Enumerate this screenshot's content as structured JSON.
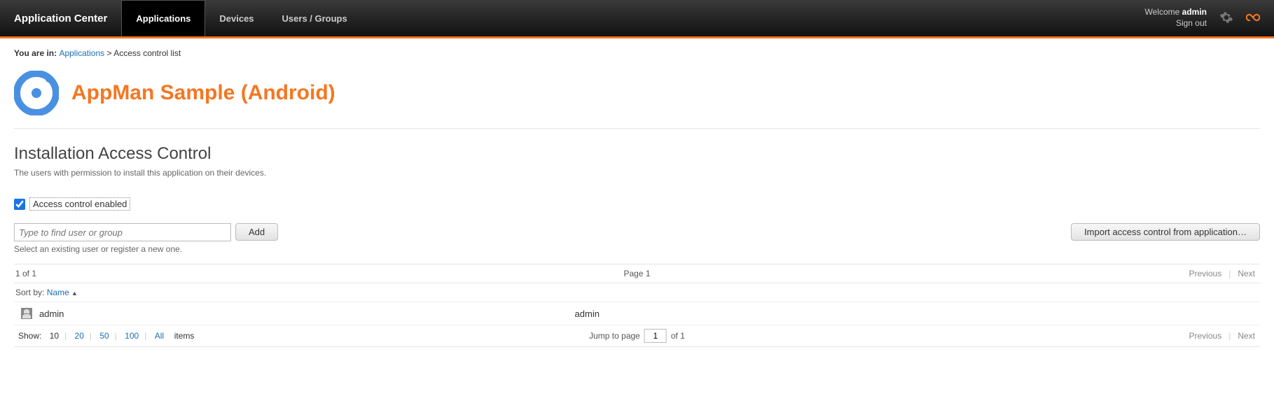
{
  "header": {
    "brand": "Application Center",
    "tabs": [
      {
        "label": "Applications",
        "active": true
      },
      {
        "label": "Devices",
        "active": false
      },
      {
        "label": "Users / Groups",
        "active": false
      }
    ],
    "welcome_prefix": "Welcome ",
    "username": "admin",
    "signout": "Sign out"
  },
  "breadcrumb": {
    "prefix": "You are in: ",
    "link": "Applications",
    "sep": " > ",
    "current": "Access control list"
  },
  "app": {
    "title": "AppMan Sample (Android)"
  },
  "section": {
    "title": "Installation Access Control",
    "desc": "The users with permission to install this application on their devices."
  },
  "access_control": {
    "checkbox_label": "Access control enabled",
    "checked": true
  },
  "search": {
    "placeholder": "Type to find user or group",
    "add_label": "Add",
    "helper": "Select an existing user or register a new one.",
    "import_label": "Import access control from application…"
  },
  "list": {
    "count_text": "1 of 1",
    "page_label": "Page 1",
    "prev": "Previous",
    "next": "Next",
    "sort_label": "Sort by: ",
    "sort_field": "Name",
    "rows": [
      {
        "name": "admin",
        "login": "admin"
      }
    ],
    "show_label": "Show:",
    "show_options": [
      "10",
      "20",
      "50",
      "100",
      "All"
    ],
    "show_current": "10",
    "show_suffix": "items",
    "jump_label": "Jump to page",
    "jump_value": "1",
    "jump_suffix": "of 1"
  }
}
